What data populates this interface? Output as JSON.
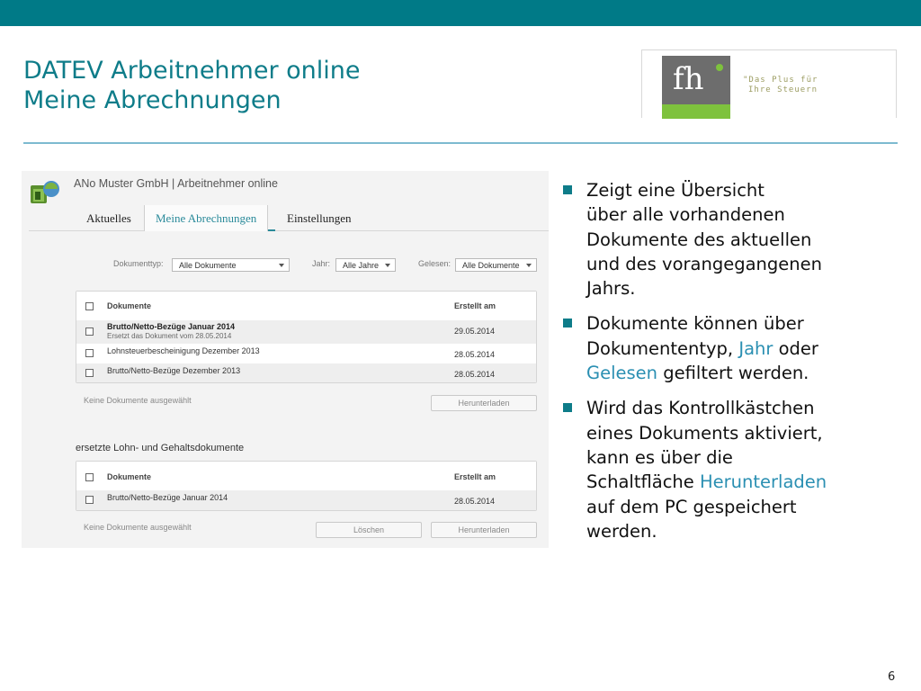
{
  "slide": {
    "title_line1": "DATEV Arbeitnehmer online",
    "title_line2": "Meine Abrechnungen",
    "page_number": "6",
    "colors": {
      "header_bar": "#007a87",
      "title": "#0e7c89",
      "accent": "#2a8fb2",
      "logo_green": "#7ec23d"
    }
  },
  "logo": {
    "mark": "fh",
    "tagline_line1": "\"Das Plus für",
    "tagline_line2": "Ihre Steuern"
  },
  "app": {
    "window_title": "ANo Muster GmbH | Arbeitnehmer online",
    "icon": "app-logo-icon",
    "tabs": [
      {
        "label": "Aktuelles",
        "active": false
      },
      {
        "label": "Meine Abrechnungen",
        "active": true
      },
      {
        "label": "Einstellungen",
        "active": false
      }
    ],
    "filters": {
      "doktyp_label": "Dokumenttyp:",
      "doktyp_value": "Alle Dokumente",
      "jahr_label": "Jahr:",
      "jahr_value": "Alle Jahre",
      "gelesen_label": "Gelesen:",
      "gelesen_value": "Alle Dokumente"
    },
    "table1": {
      "col_doc": "Dokumente",
      "col_date": "Erstellt am",
      "rows": [
        {
          "doc": "Brutto/Netto-Bezüge Januar 2014",
          "sub": "Ersetzt das Dokument vom 28.05.2014",
          "date": "29.05.2014",
          "unread": true
        },
        {
          "doc": "Lohnsteuerbescheinigung Dezember 2013",
          "date": "28.05.2014"
        },
        {
          "doc": "Brutto/Netto-Bezüge Dezember 2013",
          "date": "28.05.2014"
        }
      ],
      "none_selected": "Keine Dokumente ausgewählt",
      "download_label": "Herunterladen"
    },
    "section2_title": "ersetzte Lohn- und Gehaltsdokumente",
    "table2": {
      "col_doc": "Dokumente",
      "col_date": "Erstellt am",
      "rows": [
        {
          "doc": "Brutto/Netto-Bezüge Januar 2014",
          "date": "28.05.2014"
        }
      ],
      "none_selected": "Keine Dokumente ausgewählt",
      "delete_label": "Löschen",
      "download_label": "Herunterladen"
    }
  },
  "bullets": {
    "b1": {
      "line1": "Zeigt eine Übersicht",
      "line2": "über alle vorhandenen",
      "line3": "Dokumente des aktuellen",
      "line4": "und des vorangegangenen",
      "line5": "Jahrs."
    },
    "b2": {
      "line1": "Dokumente können über",
      "line2a": "Dokumententyp, ",
      "line2_hl": "Jahr",
      "line2b": " oder",
      "line3_hl": "Gelesen",
      "line3b": " gefiltert werden."
    },
    "b3": {
      "line1": "Wird das Kontrollkästchen",
      "line2": "eines Dokuments aktiviert,",
      "line3": "kann es über die",
      "line4a": "Schaltfläche ",
      "line4_hl": "Herunterladen",
      "line5": "auf dem PC gespeichert",
      "line6": "werden."
    }
  }
}
